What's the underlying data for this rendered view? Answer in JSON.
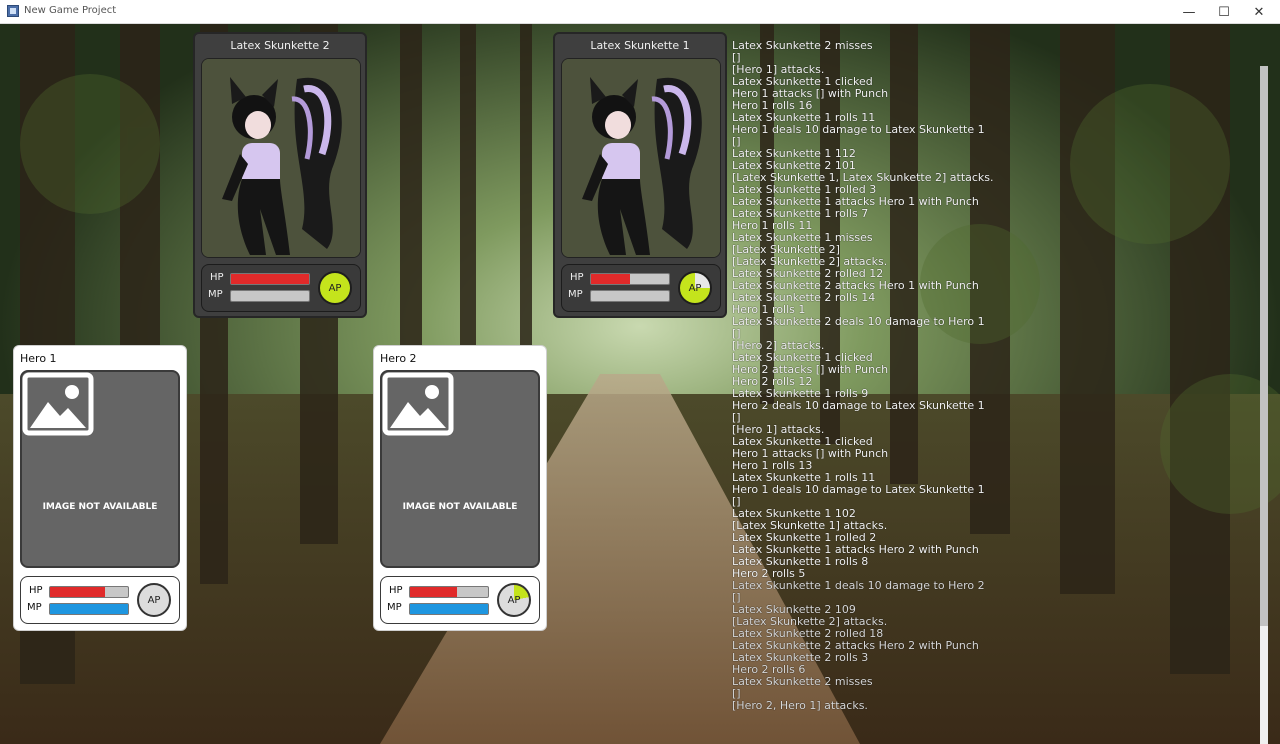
{
  "window": {
    "title": "New Game Project",
    "minimize": "—",
    "maximize": "☐",
    "close": "✕"
  },
  "enemies": [
    {
      "name": "Latex Skunkette 2",
      "hp_label": "HP",
      "mp_label": "MP",
      "ap_label": "AP",
      "hp": 1.0,
      "mp": 0.0
    },
    {
      "name": "Latex Skunkette 1",
      "hp_label": "HP",
      "mp_label": "MP",
      "ap_label": "AP",
      "hp": 0.5,
      "mp": 0.0
    }
  ],
  "heroes": [
    {
      "name": "Hero 1",
      "image_text": "IMAGE NOT AVAILABLE",
      "hp_label": "HP",
      "mp_label": "MP",
      "ap_label": "AP",
      "hp": 0.7,
      "mp": 1.0
    },
    {
      "name": "Hero 2",
      "image_text": "IMAGE NOT AVAILABLE",
      "hp_label": "HP",
      "mp_label": "MP",
      "ap_label": "AP",
      "hp": 0.6,
      "mp": 1.0
    }
  ],
  "colors": {
    "hp": "#e02a2a",
    "mp": "#1e96e0",
    "ap_full": "#c4e41c"
  },
  "log": [
    "Latex Skunkette 2 misses",
    "[]",
    "[Hero 1] attacks.",
    "Latex Skunkette 1 clicked",
    "Hero 1 attacks [] with Punch",
    "Hero 1 rolls 16",
    "Latex Skunkette 1 rolls 11",
    "Hero 1 deals 10 damage to Latex Skunkette 1",
    "[]",
    "Latex Skunkette 1 112",
    "Latex Skunkette 2 101",
    "[Latex Skunkette 1, Latex Skunkette 2] attacks.",
    "Latex Skunkette 1 rolled 3",
    "Latex Skunkette 1 attacks Hero 1 with Punch",
    "Latex Skunkette 1 rolls 7",
    "Hero 1 rolls 11",
    "Latex Skunkette 1 misses",
    "[Latex Skunkette 2]",
    "[Latex Skunkette 2] attacks.",
    "Latex Skunkette 2 rolled 12",
    "Latex Skunkette 2 attacks Hero 1 with Punch",
    "Latex Skunkette 2 rolls 14",
    "Hero 1 rolls 1",
    "Latex Skunkette 2 deals 10 damage to Hero 1",
    "[]",
    "[Hero 2] attacks.",
    "Latex Skunkette 1 clicked",
    "Hero 2 attacks [] with Punch",
    "Hero 2 rolls 12",
    "Latex Skunkette 1 rolls 9",
    "Hero 2 deals 10 damage to Latex Skunkette 1",
    "[]",
    "[Hero 1] attacks.",
    "Latex Skunkette 1 clicked",
    "Hero 1 attacks [] with Punch",
    "Hero 1 rolls 13",
    "Latex Skunkette 1 rolls 11",
    "Hero 1 deals 10 damage to Latex Skunkette 1",
    "[]",
    "Latex Skunkette 1 102",
    "[Latex Skunkette 1] attacks.",
    "Latex Skunkette 1 rolled 2",
    "Latex Skunkette 1 attacks Hero 2 with Punch",
    "Latex Skunkette 1 rolls 8",
    "Hero 2 rolls 5",
    "Latex Skunkette 1 deals 10 damage to Hero 2",
    "[]",
    "Latex Skunkette 2 109",
    "[Latex Skunkette 2] attacks.",
    "Latex Skunkette 2 rolled 18",
    "Latex Skunkette 2 attacks Hero 2 with Punch",
    "Latex Skunkette 2 rolls 3",
    "Hero 2 rolls 6",
    "Latex Skunkette 2 misses",
    "[]",
    "[Hero 2, Hero 1] attacks."
  ]
}
